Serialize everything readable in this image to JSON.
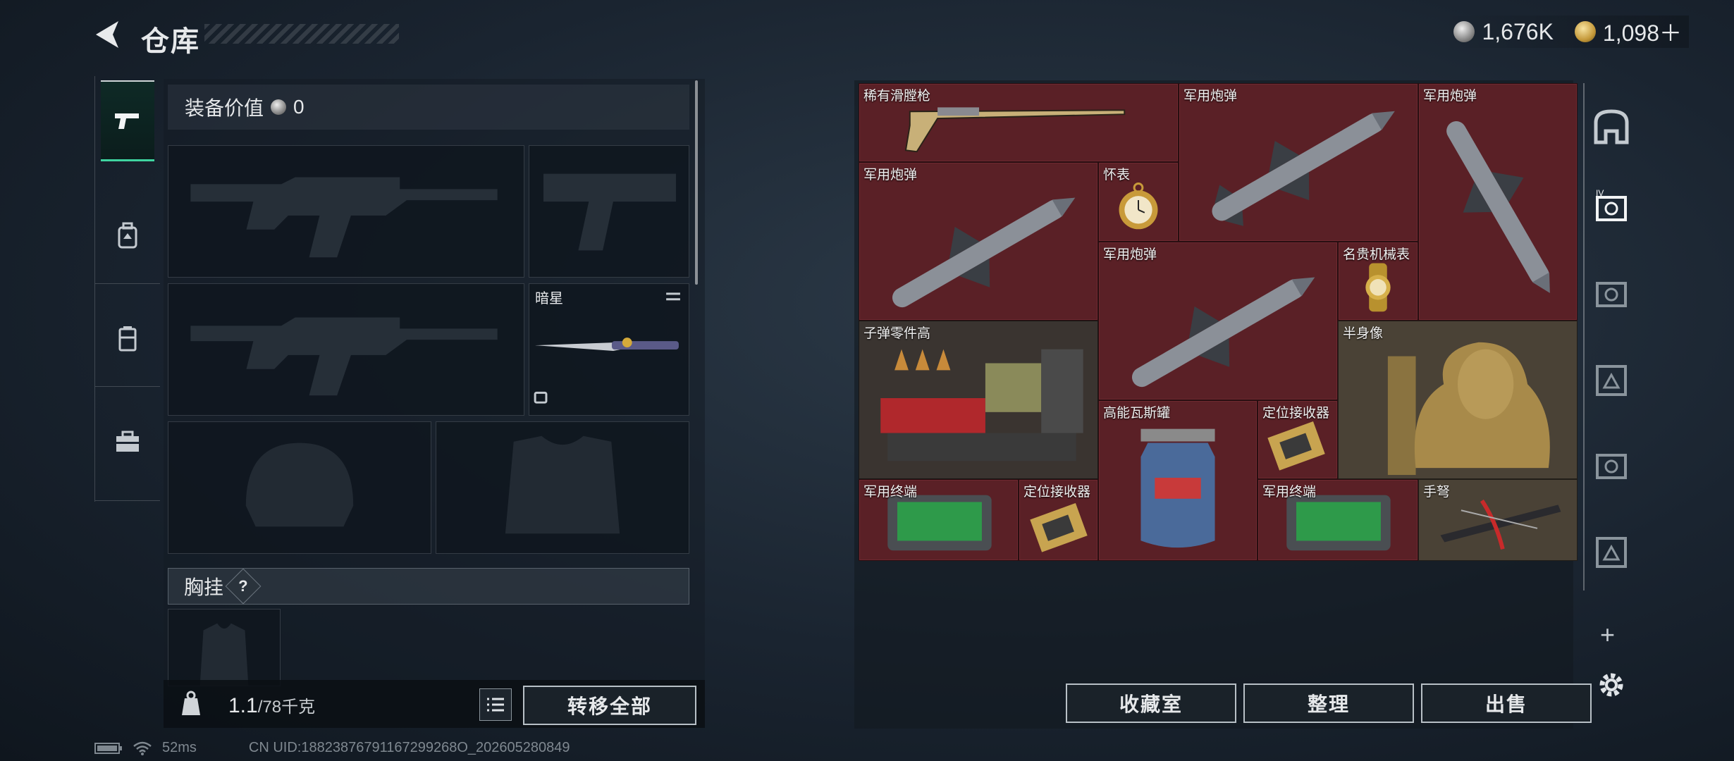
{
  "header": {
    "title": "仓库",
    "currencies": [
      {
        "icon": "silver-coin-icon",
        "value": "1,676K"
      },
      {
        "icon": "gold-coin-icon",
        "value": "1,098＋"
      }
    ]
  },
  "left_tabs": [
    {
      "icon": "pistol-icon",
      "active": true
    },
    {
      "icon": "backpack-icon",
      "active": false
    },
    {
      "icon": "rig-icon",
      "active": false
    },
    {
      "icon": "toolbox-icon",
      "active": false
    }
  ],
  "equipment": {
    "value_label": "装备价值",
    "value": "0",
    "melee_label": "暗星",
    "chest_rig_label": "胸挂",
    "help_mark": "?"
  },
  "capacity": {
    "current": "1.1",
    "max": "/78千克"
  },
  "buttons": {
    "transfer_all": "转移全部",
    "collection": "收藏室",
    "organize": "整理",
    "sell": "出售",
    "add": "+"
  },
  "storage_items": [
    {
      "name": "稀有滑膛枪",
      "icon": "musket-icon"
    },
    {
      "name": "军用炮弹",
      "icon": "missile-icon"
    },
    {
      "name": "军用炮弹",
      "icon": "missile-icon"
    },
    {
      "name": "军用炮弹",
      "icon": "missile-icon"
    },
    {
      "name": "怀表",
      "icon": "pocket-watch-icon"
    },
    {
      "name": "军用炮弹",
      "icon": "missile-icon"
    },
    {
      "name": "名贵机械表",
      "icon": "wristwatch-icon"
    },
    {
      "name": "子弹零件高",
      "icon": "ammo-parts-icon"
    },
    {
      "name": "半身像",
      "icon": "bust-icon"
    },
    {
      "name": "高能瓦斯罐",
      "icon": "gas-canister-icon"
    },
    {
      "name": "定位接收器",
      "icon": "receiver-icon"
    },
    {
      "name": "军用终端",
      "icon": "terminal-icon"
    },
    {
      "name": "定位接收器",
      "icon": "receiver-icon"
    },
    {
      "name": "军用终端",
      "icon": "terminal-icon"
    },
    {
      "name": "手弩",
      "icon": "crossbow-icon"
    }
  ],
  "status": {
    "ping": "52ms",
    "uid": "CN UID:18823876791167299268O_202605280849"
  }
}
